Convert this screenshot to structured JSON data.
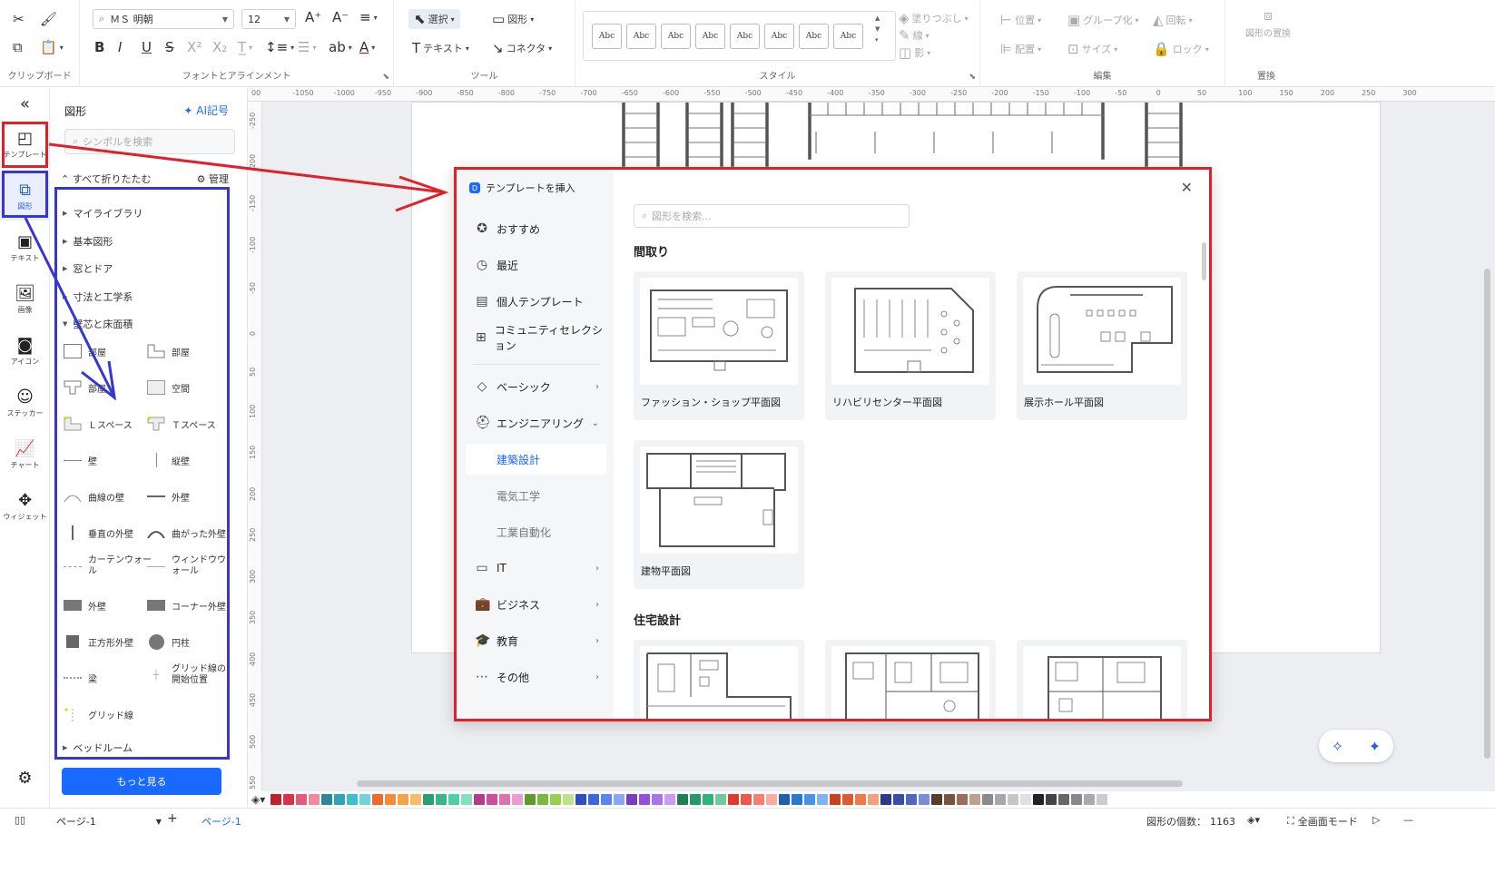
{
  "ribbon": {
    "clipboard_label": "クリップボード",
    "font_group_label": "フォントとアラインメント",
    "tools_group_label": "ツール",
    "style_group_label": "スタイル",
    "edit_group_label": "編集",
    "replace_group_label": "置換",
    "font_name": "ＭＳ 明朝",
    "font_size": "12",
    "select_label": "選択",
    "shape_label": "図形",
    "text_label": "テキスト",
    "connector_label": "コネクタ",
    "style_swatch_text": "Abc",
    "fill_label": "塗りつぶし",
    "line_label": "線",
    "shadow_label": "影",
    "position_label": "位置",
    "group_label": "グループ化",
    "rotate_label": "回転",
    "align_label": "配置",
    "size_label": "サイズ",
    "lock_label": "ロック",
    "replace_shape_label": "図形の置換"
  },
  "rail": {
    "items": [
      {
        "label": "テンプレート",
        "icon": "template-icon"
      },
      {
        "label": "図形",
        "icon": "shapes-icon"
      },
      {
        "label": "テキスト",
        "icon": "text-icon"
      },
      {
        "label": "画像",
        "icon": "image-icon"
      },
      {
        "label": "アイコン",
        "icon": "icon-icon"
      },
      {
        "label": "ステッカー",
        "icon": "sticker-icon"
      },
      {
        "label": "チャート",
        "icon": "chart-icon"
      },
      {
        "label": "ウィジェット",
        "icon": "widget-icon"
      }
    ]
  },
  "shapes_panel": {
    "title": "図形",
    "ai_label": "AI記号",
    "search_placeholder": "シンボルを検索",
    "collapse_all": "すべて折りたたむ",
    "manage": "管理",
    "categories": [
      "マイライブラリ",
      "基本図形",
      "窓とドア",
      "寸法と工学系",
      "壁芯と床面積"
    ],
    "shapes": [
      "部屋",
      "部屋",
      "部屋",
      "空間",
      "Ｌスペース",
      "Ｔスペース",
      "壁",
      "縦壁",
      "曲線の壁",
      "外壁",
      "垂直の外壁",
      "曲がった外壁",
      "カーテンウォール",
      "ウィンドウウォール",
      "外壁",
      "コーナー外壁",
      "正方形外壁",
      "円柱",
      "梁",
      "グリッド線の開始位置",
      "グリッド線"
    ],
    "bottom_category": "ベッドルーム",
    "more_button": "もっと見る"
  },
  "ruler": {
    "h_ticks": [
      "00",
      "-1050",
      "-1000",
      "-950",
      "-900",
      "-850",
      "-800",
      "-750",
      "-700",
      "-650",
      "-600",
      "-550",
      "-500",
      "-450",
      "-400",
      "-350",
      "-300",
      "-250",
      "-200",
      "-150",
      "-100",
      "-50",
      "0",
      "50",
      "100",
      "150",
      "200",
      "250",
      "300"
    ],
    "v_ticks": [
      "-250",
      "-200",
      "-150",
      "-100",
      "-50",
      "0",
      "50",
      "100",
      "150",
      "200",
      "250",
      "300",
      "350",
      "400",
      "450",
      "500",
      "550"
    ]
  },
  "modal": {
    "title": "テンプレートを挿入",
    "search_placeholder": "図形を検索...",
    "nav": [
      {
        "label": "おすすめ",
        "icon": "star-badge-icon"
      },
      {
        "label": "最近",
        "icon": "clock-icon"
      },
      {
        "label": "個人テンプレート",
        "icon": "document-icon"
      },
      {
        "label": "コミュニティセレクション",
        "icon": "community-icon"
      }
    ],
    "categories": [
      {
        "label": "ベーシック",
        "icon": "tag-icon"
      },
      {
        "label": "エンジニアリング",
        "icon": "helmet-icon"
      },
      {
        "label": "IT",
        "icon": "server-icon"
      },
      {
        "label": "ビジネス",
        "icon": "briefcase-icon"
      },
      {
        "label": "教育",
        "icon": "graduation-icon"
      },
      {
        "label": "その他",
        "icon": "more-icon"
      }
    ],
    "sub_categories": [
      "建築設計",
      "電気工学",
      "工業自動化"
    ],
    "section1": "間取り",
    "section2": "住宅設計",
    "cards": [
      "ファッション・ショップ平面図",
      "リハビリセンター平面図",
      "展示ホール平面図",
      "建物平面図"
    ]
  },
  "palette_colors": [
    "#c0222b",
    "#d8334b",
    "#e85a7a",
    "#f08aa1",
    "#2a8a9a",
    "#31a3b5",
    "#3cc0d0",
    "#6fd3e0",
    "#f26a2b",
    "#f58a3a",
    "#f7a34a",
    "#f9bc6b",
    "#2aa072",
    "#36b887",
    "#4ed0a0",
    "#86e0c0",
    "#b33c8c",
    "#c9509f",
    "#dd6fb5",
    "#eb9cd0",
    "#5d9b2a",
    "#78b83a",
    "#96cf52",
    "#bce38a",
    "#2e4fc0",
    "#3f67dc",
    "#5b84ee",
    "#8aa8f4",
    "#7a3cc0",
    "#9350d8",
    "#ad72ea",
    "#c99bf3",
    "#1e7f56",
    "#259a68",
    "#31b47c",
    "#6ccc9e",
    "#e03a2a",
    "#ee5a4a",
    "#f5806f",
    "#fbaaa0",
    "#1e5fb0",
    "#2b78d0",
    "#4a92e6",
    "#80b4f0",
    "#c9421e",
    "#e05a2e",
    "#ee7a4a",
    "#f5a07a",
    "#2a3a8a",
    "#3a4ea8",
    "#5066c4",
    "#7a8ed8",
    "#5a3a2a",
    "#7a5240",
    "#9a6e5a",
    "#c0a090",
    "#8a8a8a",
    "#a8a8a8",
    "#c6c6c6",
    "#e0e0e0",
    "#222222",
    "#444444",
    "#666666",
    "#888888",
    "#aaaaaa",
    "#cccccc"
  ],
  "status": {
    "page_selector": "ページ-1",
    "add_page": "+",
    "page_tab": "ページ-1",
    "shape_count_label": "図形の個数：",
    "shape_count": "1163",
    "fullscreen_label": "全画面モード"
  },
  "colors": {
    "accent": "#1769ff",
    "annotation_red": "#e0212a",
    "annotation_blue": "#3636d6"
  }
}
